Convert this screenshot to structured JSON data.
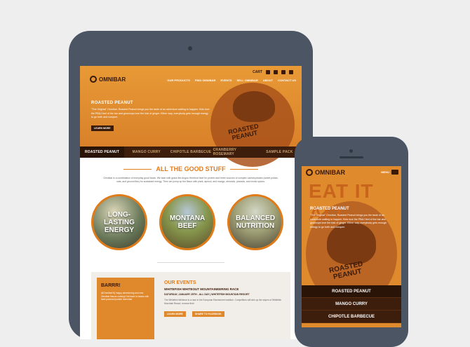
{
  "tablet": {
    "brand": "OMNIBAR",
    "cart": "CART",
    "nav": [
      "OUR PRODUCTS",
      "FIND OMNIBAR",
      "EVENTS",
      "SELL OMNIBAR",
      "ABOUT",
      "CONTACT US"
    ],
    "hero": {
      "title": "ROASTED PEANUT",
      "text": "\"The Original\" Omnibar, Roasted Peanut brings you the taste of an adventure waiting to happen. Kids love the PB&J feel of the bar and grownups love the kick of ginger. Either way, everybody gets enough energy to go forth and conquer.",
      "button": "LEARN MORE",
      "badge_line1": "ROASTED",
      "badge_line2": "PEANUT"
    },
    "tabs": [
      "ROASTED PEANUT",
      "MANGO CURRY",
      "CHIPOTLE BARBECUE",
      "CRANBERRY ROSEMARY",
      "SAMPLE PACK"
    ],
    "good_stuff": {
      "title": "ALL THE GOOD STUFF",
      "text": "Omnibar is a combination of everyday good foods. We start with grass fed Angus Hereford beef for protein and three sources of complex carbohydrates (sweet potato, oats, and ground flax) for sustained energy. Then we pump up the flavor with plant, apricot, and mango, almonds, peanuts, and exotic spices."
    },
    "circles": [
      {
        "line1": "LONG-LASTING",
        "line2": "ENERGY"
      },
      {
        "line1": "MONTANA",
        "line2": "BEEF"
      },
      {
        "line1": "BALANCED",
        "line2": "NUTRITION"
      }
    ],
    "promo": {
      "title": "BARRR!",
      "text": "@OmnibarHQ happy adventuring and new Omnibar flavors coming! Get back to basics with beef-powered protein #omnibar"
    },
    "events": {
      "title": "OUR EVENTS",
      "name": "WHITEFISH WHITEOUT MOUNTAINEERING RACE",
      "date": "SATURDAY, JANUARY 25TH - ALL DAY | WHITEFISH MOUNTAIN RESORT",
      "text": "The Whitefish Whiteout is a race in the European Randonnee tradition. Competitors will skin up the slopes of Whitefish Mountain Resort, remove their",
      "learn_more": "LEARN MORE",
      "share": "SHARE TO FACEBOOK"
    }
  },
  "phone": {
    "brand": "OMNIBAR",
    "menu": "MENU",
    "headline": "EAT IT ALL",
    "title": "ROASTED PEANUT",
    "text": "\"The Original\" Omnibar, Roasted Peanut brings you the taste of an adventure waiting to happen. Kids love the PB&J feel of the bar and grownups love the kick of ginger. Either way, everybody gets enough energy to go forth and conquer.",
    "badge_line1": "ROASTED",
    "badge_line2": "PEANUT",
    "menu_items": [
      "ROASTED PEANUT",
      "MANGO CURRY",
      "CHIPOTLE BARBECUE"
    ]
  },
  "colors": {
    "orange": "#e08a2e",
    "dark_brown": "#3a1a08",
    "device": "#4b5563"
  }
}
